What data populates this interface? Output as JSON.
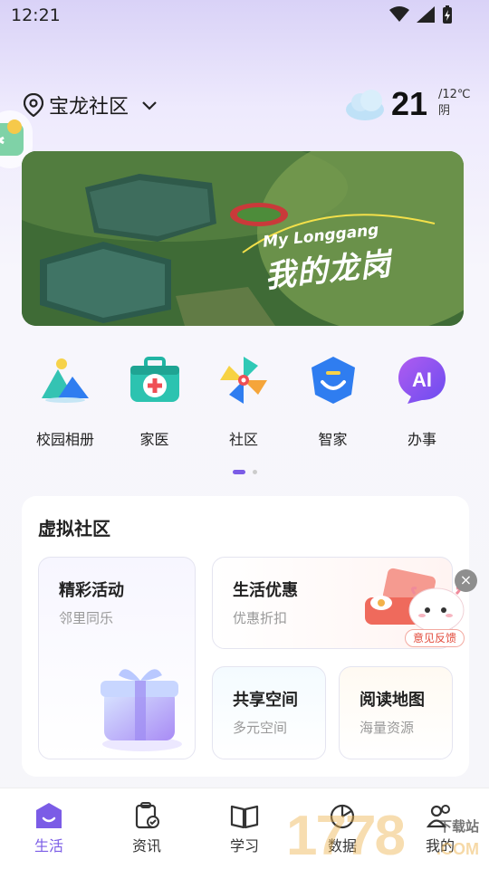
{
  "status_bar": {
    "time": "12:21"
  },
  "header": {
    "location": "宝龙社区",
    "temperature": "21",
    "temp_unit_low": "/12℃",
    "weather_text": "阴"
  },
  "banner": {
    "subtitle": "My Longgang",
    "title": "我的龙岗"
  },
  "quick_actions": [
    {
      "label": "校园相册",
      "icon": "mountain-photo-icon"
    },
    {
      "label": "家医",
      "icon": "medical-kit-icon"
    },
    {
      "label": "社区",
      "icon": "pinwheel-icon"
    },
    {
      "label": "智家",
      "icon": "smile-shield-icon"
    },
    {
      "label": "办事",
      "icon": "ai-chat-icon"
    }
  ],
  "pager": {
    "active_index": 0,
    "total": 2
  },
  "virtual_community": {
    "title": "虚拟社区",
    "cards": [
      {
        "title": "精彩活动",
        "sub": "邻里同乐"
      },
      {
        "title": "生活优惠",
        "sub": "优惠折扣"
      },
      {
        "title": "共享空间",
        "sub": "多元空间"
      },
      {
        "title": "阅读地图",
        "sub": "海量资源"
      }
    ]
  },
  "feedback": {
    "label": "意见反馈"
  },
  "tabbar": [
    {
      "label": "生活",
      "active": true
    },
    {
      "label": "资讯",
      "active": false
    },
    {
      "label": "学习",
      "active": false
    },
    {
      "label": "数据",
      "active": false
    },
    {
      "label": "我的",
      "active": false
    }
  ],
  "watermark": {
    "text": "1778",
    "site": "下载站",
    "domain": ".COM"
  },
  "colors": {
    "accent": "#7b5ce6",
    "feedback": "#e24b3c"
  }
}
